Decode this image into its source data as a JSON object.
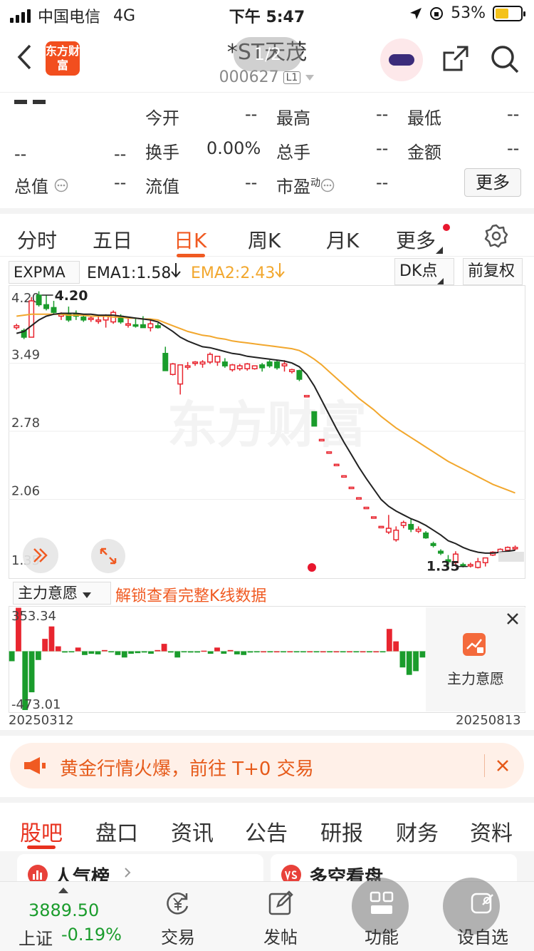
{
  "status": {
    "carrier": "中国电信",
    "network": "4G",
    "time": "下午 5:47",
    "battery": "53%",
    "battery_level": 0.53
  },
  "header": {
    "logo_text": "东方财富",
    "stock_name": "*ST天茂",
    "stock_code": "000627",
    "level_badge": "L1",
    "pager": "1/2"
  },
  "quote": {
    "price": "--",
    "change": "--",
    "change_pct": "--",
    "open_label": "今开",
    "open": "--",
    "high_label": "最高",
    "high": "--",
    "low_label": "最低",
    "low": "--",
    "turnover_label": "换手",
    "turnover": "0.00%",
    "volume_label": "总手",
    "volume": "--",
    "amount_label": "金额",
    "amount": "--",
    "mktcap_label": "总值",
    "mktcap": "--",
    "float_label": "流值",
    "float": "--",
    "pe_label": "市盈",
    "pe_sup": "动",
    "pe": "--",
    "more": "更多"
  },
  "period_tabs": [
    "分时",
    "五日",
    "日K",
    "周K",
    "月K",
    "更多"
  ],
  "active_period": "日K",
  "indicator": {
    "name": "EXPMA",
    "ema1": "EMA1:1.58",
    "ema2": "EMA2:2.43",
    "dk": "DK点",
    "adjust": "前复权"
  },
  "sub_indicator": {
    "name": "主力意愿",
    "unlock": "解锁查看完整K线数据",
    "card_label": "主力意愿"
  },
  "colors": {
    "up": "#e8252f",
    "down": "#1a9c2c",
    "ema1": "#222222",
    "ema2": "#f2a72d",
    "accent": "#f05a22"
  },
  "chart_data": [
    {
      "type": "candlestick",
      "y_ticks": [
        "4.20",
        "3.49",
        "2.78",
        "2.06",
        "1.35"
      ],
      "ylim": [
        1.35,
        4.2
      ],
      "max_label": "4.20",
      "min_label": "1.35",
      "watermark": "东方财富",
      "candles": [
        [
          3.86,
          3.9,
          3.84,
          3.88
        ],
        [
          3.83,
          3.85,
          3.74,
          3.76
        ],
        [
          3.76,
          4.18,
          3.76,
          4.14
        ],
        [
          4.2,
          4.24,
          4.08,
          4.1
        ],
        [
          4.1,
          4.2,
          4.04,
          4.06
        ],
        [
          4.07,
          4.14,
          4.0,
          4.02
        ],
        [
          3.98,
          4.02,
          3.94,
          4.0
        ],
        [
          4.0,
          4.08,
          3.92,
          3.94
        ],
        [
          4.0,
          4.04,
          3.94,
          3.98
        ],
        [
          3.97,
          4.0,
          3.92,
          3.94
        ],
        [
          3.95,
          3.98,
          3.92,
          3.96
        ],
        [
          3.93,
          3.98,
          3.9,
          3.94
        ],
        [
          3.94,
          4.0,
          3.86,
          3.98
        ],
        [
          3.92,
          4.04,
          3.9,
          4.02
        ],
        [
          3.98,
          4.0,
          3.9,
          3.92
        ],
        [
          3.9,
          3.96,
          3.86,
          3.9
        ],
        [
          3.89,
          3.96,
          3.86,
          3.88
        ],
        [
          3.89,
          3.98,
          3.86,
          3.86
        ],
        [
          3.86,
          3.94,
          3.82,
          3.9
        ],
        [
          3.88,
          3.91,
          3.85,
          3.86
        ],
        [
          3.59,
          3.66,
          3.43,
          3.41
        ],
        [
          3.37,
          3.49,
          3.36,
          3.48
        ],
        [
          3.27,
          3.43,
          3.16,
          3.47
        ],
        [
          3.45,
          3.5,
          3.42,
          3.46
        ],
        [
          3.49,
          3.51,
          3.46,
          3.5
        ],
        [
          3.48,
          3.52,
          3.44,
          3.5
        ],
        [
          3.5,
          3.6,
          3.48,
          3.58
        ],
        [
          3.5,
          3.56,
          3.46,
          3.56
        ],
        [
          3.5,
          3.54,
          3.44,
          3.46
        ],
        [
          3.42,
          3.48,
          3.4,
          3.47
        ],
        [
          3.43,
          3.48,
          3.41,
          3.46
        ],
        [
          3.43,
          3.49,
          3.41,
          3.48
        ],
        [
          3.43,
          3.46,
          3.42,
          3.46
        ],
        [
          3.47,
          3.49,
          3.4,
          3.44
        ],
        [
          3.5,
          3.52,
          3.44,
          3.46
        ],
        [
          3.5,
          3.52,
          3.42,
          3.44
        ],
        [
          3.46,
          3.52,
          3.4,
          3.48
        ],
        [
          3.4,
          3.43,
          3.38,
          3.42
        ],
        [
          3.41,
          3.42,
          3.3,
          3.32
        ],
        [
          3.15,
          3.15,
          3.15,
          3.15
        ],
        [
          2.98,
          2.98,
          2.92,
          2.83
        ],
        [
          2.69,
          2.69,
          2.69,
          2.69
        ],
        [
          2.56,
          2.56,
          2.56,
          2.56
        ],
        [
          2.43,
          2.43,
          2.43,
          2.43
        ],
        [
          2.31,
          2.31,
          2.31,
          2.31
        ],
        [
          2.19,
          2.19,
          2.19,
          2.19
        ],
        [
          2.08,
          2.08,
          2.08,
          2.08
        ],
        [
          1.98,
          1.98,
          1.98,
          1.98
        ],
        [
          1.88,
          1.88,
          1.88,
          1.88
        ],
        [
          1.78,
          1.78,
          1.78,
          1.78
        ],
        [
          1.72,
          1.9,
          1.7,
          1.76
        ],
        [
          1.64,
          1.78,
          1.62,
          1.74
        ],
        [
          1.79,
          1.84,
          1.76,
          1.82
        ],
        [
          1.8,
          1.86,
          1.72,
          1.75
        ],
        [
          1.73,
          1.78,
          1.71,
          1.75
        ],
        [
          1.71,
          1.73,
          1.65,
          1.66
        ],
        [
          1.6,
          1.62,
          1.56,
          1.58
        ],
        [
          1.52,
          1.54,
          1.48,
          1.5
        ],
        [
          1.43,
          1.48,
          1.36,
          1.41
        ],
        [
          1.4,
          1.52,
          1.36,
          1.49
        ],
        [
          1.38,
          1.4,
          1.35,
          1.37
        ],
        [
          1.38,
          1.4,
          1.35,
          1.38
        ],
        [
          1.35,
          1.45,
          1.34,
          1.41
        ],
        [
          1.4,
          1.45,
          1.36,
          1.45
        ],
        [
          1.48,
          1.52,
          1.47,
          1.51
        ],
        [
          1.51,
          1.55,
          1.5,
          1.54
        ],
        [
          1.53,
          1.57,
          1.52,
          1.56
        ],
        [
          1.55,
          1.58,
          1.53,
          1.56
        ]
      ],
      "ema1": [
        3.8,
        3.82,
        3.88,
        3.94,
        3.98,
        4.0,
        4.01,
        4.01,
        4.01,
        4.0,
        4.0,
        3.99,
        3.99,
        3.99,
        3.98,
        3.97,
        3.96,
        3.95,
        3.94,
        3.92,
        3.87,
        3.82,
        3.76,
        3.72,
        3.69,
        3.66,
        3.65,
        3.63,
        3.61,
        3.59,
        3.58,
        3.56,
        3.55,
        3.54,
        3.53,
        3.52,
        3.51,
        3.49,
        3.45,
        3.37,
        3.25,
        3.1,
        2.95,
        2.8,
        2.66,
        2.53,
        2.4,
        2.28,
        2.17,
        2.06,
        1.99,
        1.94,
        1.9,
        1.86,
        1.83,
        1.79,
        1.74,
        1.69,
        1.63,
        1.6,
        1.56,
        1.53,
        1.51,
        1.5,
        1.5,
        1.51,
        1.52,
        1.53
      ],
      "ema2": [
        3.98,
        3.99,
        4.0,
        4.0,
        4.0,
        4.0,
        4.0,
        3.99,
        3.99,
        3.99,
        3.98,
        3.98,
        3.98,
        3.97,
        3.97,
        3.96,
        3.96,
        3.95,
        3.95,
        3.94,
        3.91,
        3.88,
        3.85,
        3.82,
        3.8,
        3.78,
        3.77,
        3.75,
        3.74,
        3.72,
        3.71,
        3.7,
        3.69,
        3.68,
        3.67,
        3.66,
        3.65,
        3.64,
        3.62,
        3.58,
        3.53,
        3.47,
        3.4,
        3.33,
        3.26,
        3.19,
        3.12,
        3.06,
        3.0,
        2.93,
        2.87,
        2.81,
        2.76,
        2.71,
        2.66,
        2.61,
        2.56,
        2.51,
        2.46,
        2.42,
        2.38,
        2.34,
        2.3,
        2.26,
        2.22,
        2.19,
        2.16,
        2.13
      ]
    },
    {
      "type": "bar",
      "y_ticks": [
        "353.34",
        "-473.01"
      ],
      "ylim": [
        -473.01,
        353.34
      ],
      "x_range": [
        "20250312",
        "20250813"
      ],
      "values": [
        -80,
        350,
        -473,
        -330,
        -70,
        100,
        200,
        40,
        -10,
        -5,
        30,
        -30,
        -20,
        -25,
        10,
        -5,
        -30,
        -50,
        -20,
        -15,
        -10,
        -20,
        10,
        60,
        -10,
        -50,
        -5,
        -10,
        -10,
        5,
        -20,
        30,
        -20,
        10,
        -25,
        -30,
        -10,
        -5,
        0,
        -3,
        0,
        -3,
        0,
        -3,
        -3,
        0,
        -3,
        0,
        -3,
        0,
        -3,
        0,
        -3,
        0,
        -3,
        0,
        -3,
        180,
        80,
        -130,
        -190,
        -160,
        -50
      ]
    }
  ],
  "promo": {
    "text": "黄金行情火爆，前往 T+0 交易"
  },
  "bottom_tabs": [
    "股吧",
    "盘口",
    "资讯",
    "公告",
    "研报",
    "财务",
    "资料"
  ],
  "cards": {
    "popularity": "人气榜",
    "bull_bear": "多空看盘"
  },
  "index": {
    "value": "3889.50",
    "name": "上证",
    "change": "-0.19%"
  },
  "tabbar": {
    "trade": "交易",
    "post": "发帖",
    "function": "功能",
    "watch": "设自选"
  }
}
